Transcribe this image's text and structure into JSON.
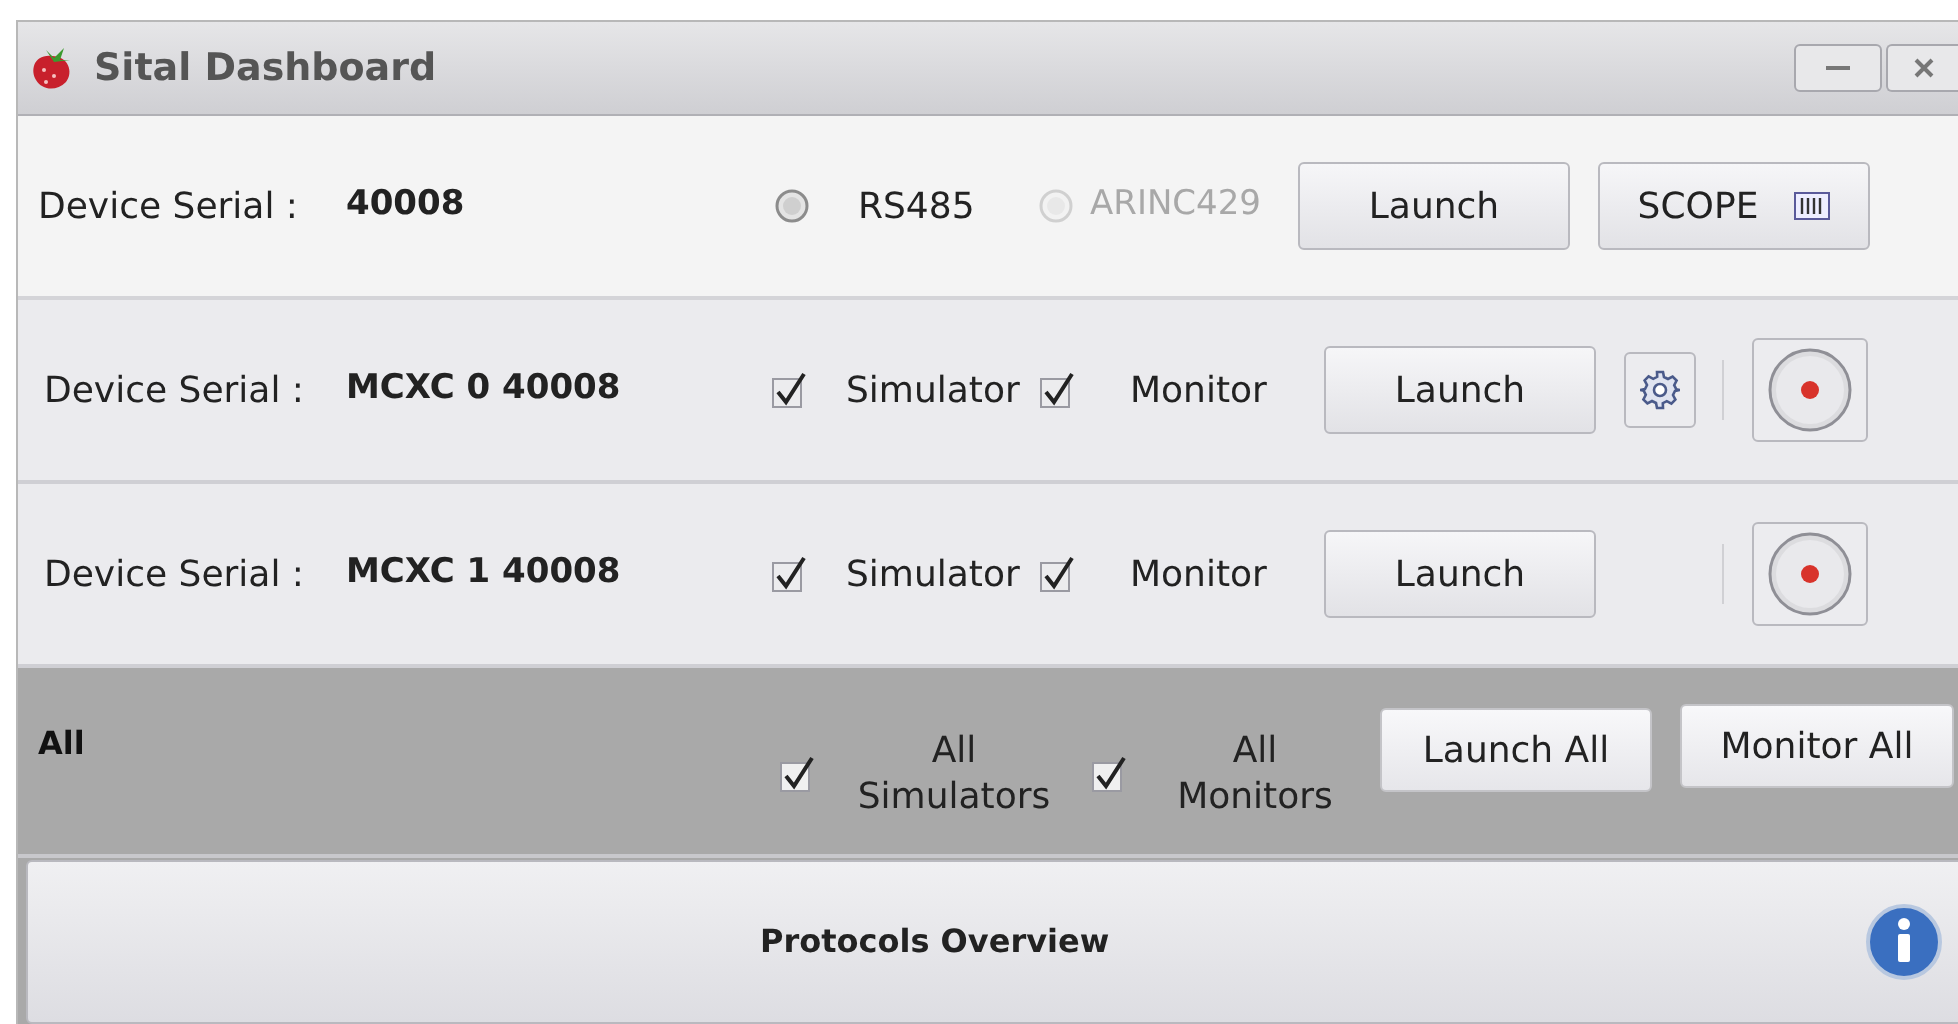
{
  "window": {
    "title": "Sital Dashboard"
  },
  "device": {
    "label": "Device Serial :",
    "serial": "40008",
    "radios": [
      {
        "label": "RS485",
        "selected": false,
        "disabled": false
      },
      {
        "label": "ARINC429",
        "selected": false,
        "disabled": true
      }
    ],
    "launch": "Launch",
    "scope": "SCOPE"
  },
  "channels": [
    {
      "label": "Device Serial :",
      "serial": "MCXC 0 40008",
      "simulator": {
        "label": "Simulator",
        "checked": true
      },
      "monitor": {
        "label": "Monitor",
        "checked": true
      },
      "launch": "Launch",
      "settings": true
    },
    {
      "label": "Device Serial :",
      "serial": "MCXC 1 40008",
      "simulator": {
        "label": "Simulator",
        "checked": true
      },
      "monitor": {
        "label": "Monitor",
        "checked": true
      },
      "launch": "Launch",
      "settings": false
    }
  ],
  "all": {
    "label": "All",
    "simulators": {
      "line1": "All",
      "line2": "Simulators",
      "checked": true
    },
    "monitors": {
      "line1": "All",
      "line2": "Monitors",
      "checked": true
    },
    "launch_all": "Launch All",
    "monitor_all": "Monitor All"
  },
  "protocols": {
    "label": "Protocols Overview"
  }
}
